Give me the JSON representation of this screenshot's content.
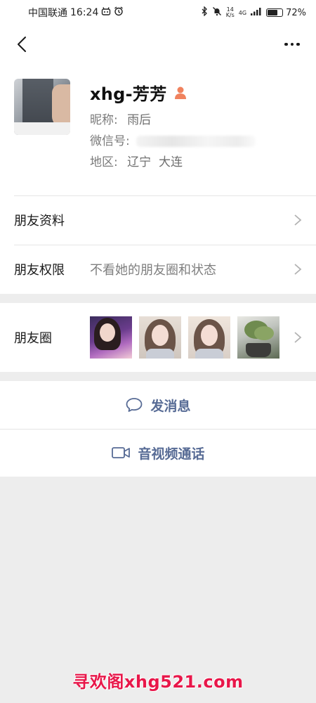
{
  "status_bar": {
    "carrier": "中国联通",
    "time": "16:24",
    "net_speed_value": "14",
    "net_speed_unit": "K/s",
    "network": "4G",
    "battery": "72%",
    "battery_level": 0.72
  },
  "profile": {
    "name": "xhg-芳芳",
    "nickname_label": "昵称:",
    "nickname": "雨后",
    "wechat_id_label": "微信号:",
    "region_label": "地区:",
    "region": "辽宁  大连"
  },
  "rows": {
    "friend_info": "朋友资料",
    "friend_permissions": "朋友权限",
    "permission_value": "不看她的朋友圈和状态",
    "moments": "朋友圈"
  },
  "actions": {
    "send_message": "发消息",
    "av_call": "音视频通话"
  },
  "watermark": "寻欢阁xhg521.com",
  "colors": {
    "link_blue": "#576b95",
    "gender_female": "#f0825e",
    "watermark_red": "#e8174a"
  }
}
